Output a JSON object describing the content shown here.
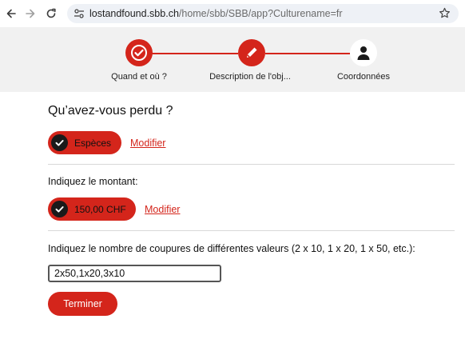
{
  "browser": {
    "url_host": "lostandfound.sbb.ch",
    "url_path": "/home/sbb/SBB/app?Culturename=fr"
  },
  "stepper": {
    "steps": [
      {
        "label": "Quand et où ?",
        "state": "done",
        "icon": "check-icon"
      },
      {
        "label": "Description de l'obj...",
        "state": "done",
        "icon": "pencil-icon"
      },
      {
        "label": "Coordonnées",
        "state": "pending",
        "icon": "person-icon"
      }
    ]
  },
  "form": {
    "question": "Qu’avez-vous perdu ?",
    "category_value": "Espèces",
    "modify_label_1": "Modifier",
    "amount_label": "Indiquez le montant:",
    "amount_value": "150,00 CHF",
    "modify_label_2": "Modifier",
    "notes_label": "Indiquez le nombre de coupures de différentes valeurs (2 x 10, 1 x 20, 1 x 50, etc.):",
    "notes_value": "2x50,1x20,3x10",
    "finish_label": "Terminer"
  },
  "colors": {
    "accent": "#d4251b",
    "stepper_bg": "#f1f1f1"
  }
}
